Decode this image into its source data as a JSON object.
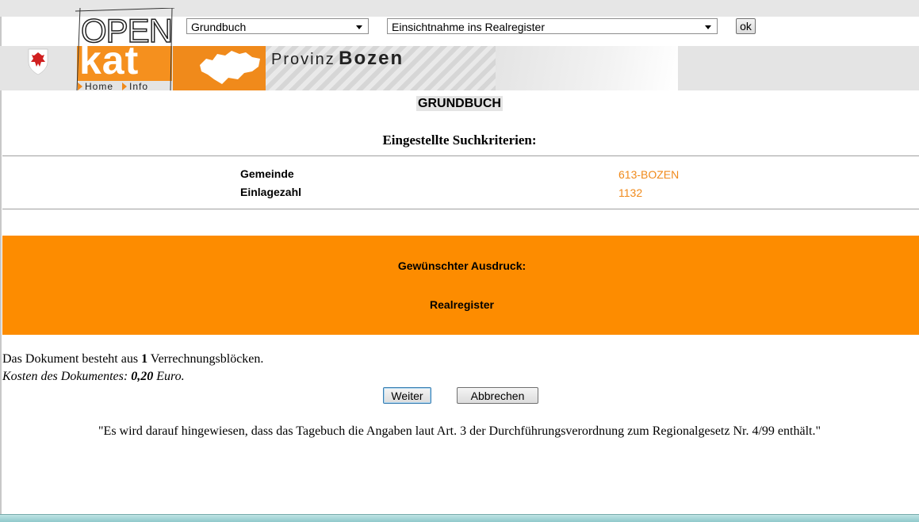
{
  "header": {
    "logo_open": "OPEN",
    "logo_kat": "kat",
    "nav_home": "Home",
    "nav_info": "Info",
    "provinz_label": "Provinz",
    "provinz_name": "Bozen",
    "select_register": "Grundbuch",
    "select_action": "Einsichtnahme ins Realregister",
    "ok_label": "ok"
  },
  "main": {
    "title": "GRUNDBUCH",
    "subtitle": "Eingestellte Suchkriterien:",
    "criteria": [
      {
        "label": "Gemeinde",
        "value": "613-BOZEN"
      },
      {
        "label": "Einlagezahl",
        "value": "1132"
      }
    ],
    "print_heading": "Gewünschter Ausdruck:",
    "print_value": "Realregister",
    "document_prefix": "Das Dokument besteht aus ",
    "document_blocks": "1",
    "document_suffix": " Verrechnungsblöcken.",
    "cost_prefix": "Kosten des Dokumentes: ",
    "cost_value": "0,20",
    "cost_suffix": " Euro.",
    "button_continue": "Weiter",
    "button_cancel": "Abbrechen",
    "note": "\"Es wird darauf hingewiesen, dass das Tagebuch die Angaben laut Art. 3 der Durchführungsverordnung zum Regionalgesetz Nr. 4/99 enthält.\""
  },
  "colors": {
    "accent_orange": "#fd8c00",
    "value_orange": "#f08a1b"
  }
}
